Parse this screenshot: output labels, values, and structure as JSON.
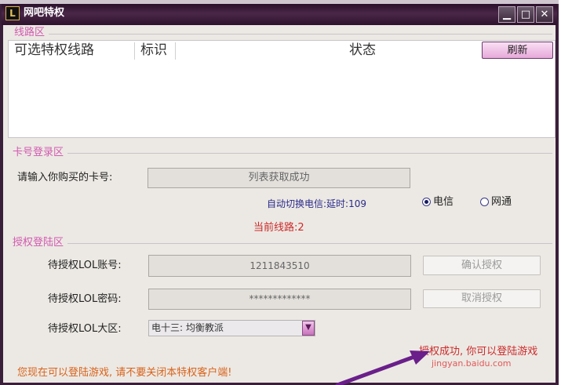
{
  "window": {
    "title": "网吧特权",
    "icon": "app-logo-icon",
    "controls": [
      "minimize-icon",
      "maximize-icon",
      "close-icon"
    ]
  },
  "line_section": {
    "label": "线路区",
    "columns": [
      "可选特权线路",
      "标识",
      "状态"
    ],
    "refresh_label": "刷新"
  },
  "card_section": {
    "label": "卡号登录区",
    "card_prompt": "请输入你购买的卡号:",
    "card_value": "列表获取成功",
    "auto_switch_text": "自动切换电信:延时:109",
    "network_options": [
      {
        "label": "电信",
        "selected": true
      },
      {
        "label": "网通",
        "selected": false
      }
    ],
    "current_line": "当前线路:2"
  },
  "auth_section": {
    "label": "授权登陆区",
    "account_label": "待授权LOL账号:",
    "account_value": "1211843510",
    "password_label": "待授权LOL密码:",
    "password_value": "*************",
    "region_label": "待授权LOL大区:",
    "region_value": "电十三: 均衡教派",
    "confirm_label": "确认授权",
    "cancel_label": "取消授权"
  },
  "footer": {
    "status_right": "授权成功, 你可以登陆游戏",
    "status_left": "您现在可以登陆游戏, 请不要关闭本特权客户端!",
    "watermark": "jingyan.baidu.com"
  },
  "colors": {
    "title_bar": "#3a1f3a",
    "section_label": "#d25ab0",
    "accent_button": "#e6a8d9",
    "status_red": "#cc2a2a",
    "status_orange": "#d9621a",
    "annotation_arrow": "#6a1f8a"
  }
}
